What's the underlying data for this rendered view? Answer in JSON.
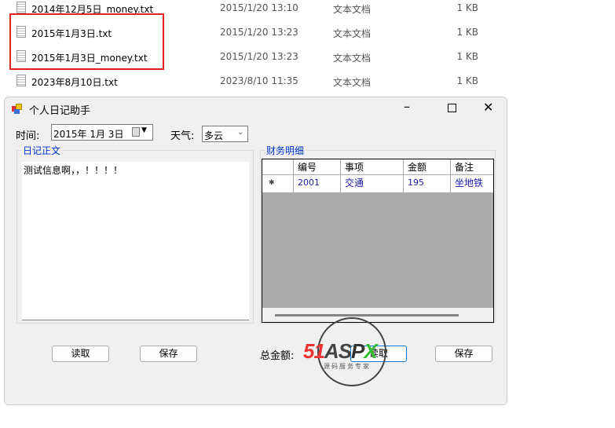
{
  "files": [
    {
      "name": "2014年12月5日_money.txt",
      "date": "2015/1/20 13:10",
      "type": "文本文档",
      "size": "1 KB"
    },
    {
      "name": "2015年1月3日.txt",
      "date": "2015/1/20 13:23",
      "type": "文本文档",
      "size": "1 KB"
    },
    {
      "name": "2015年1月3日_money.txt",
      "date": "2015/1/20 13:23",
      "type": "文本文档",
      "size": "1 KB"
    },
    {
      "name": "2023年8月10日.txt",
      "date": "2023/8/10 11:35",
      "type": "文本文档",
      "size": "1 KB"
    }
  ],
  "window": {
    "title": "个人日记助手"
  },
  "form": {
    "time_label": "时间:",
    "date_value": "2015年  1月  3日",
    "weather_label": "天气:",
    "weather_value": "多云",
    "diary_group": "日记正文",
    "diary_text": "测试信息啊，，！！！！",
    "finance_group": "财务明细",
    "columns": [
      "编号",
      "事项",
      "金额",
      "备注"
    ],
    "rows": [
      [
        "2001",
        "交通",
        "195",
        "坐地铁"
      ]
    ],
    "read_label": "读取",
    "save_label": "保存",
    "total_label": "总金额:",
    "read2_label": "读取",
    "save2_label": "保存"
  },
  "watermark": {
    "logo": "51ASPX",
    "slogan": "源码服务专家"
  }
}
